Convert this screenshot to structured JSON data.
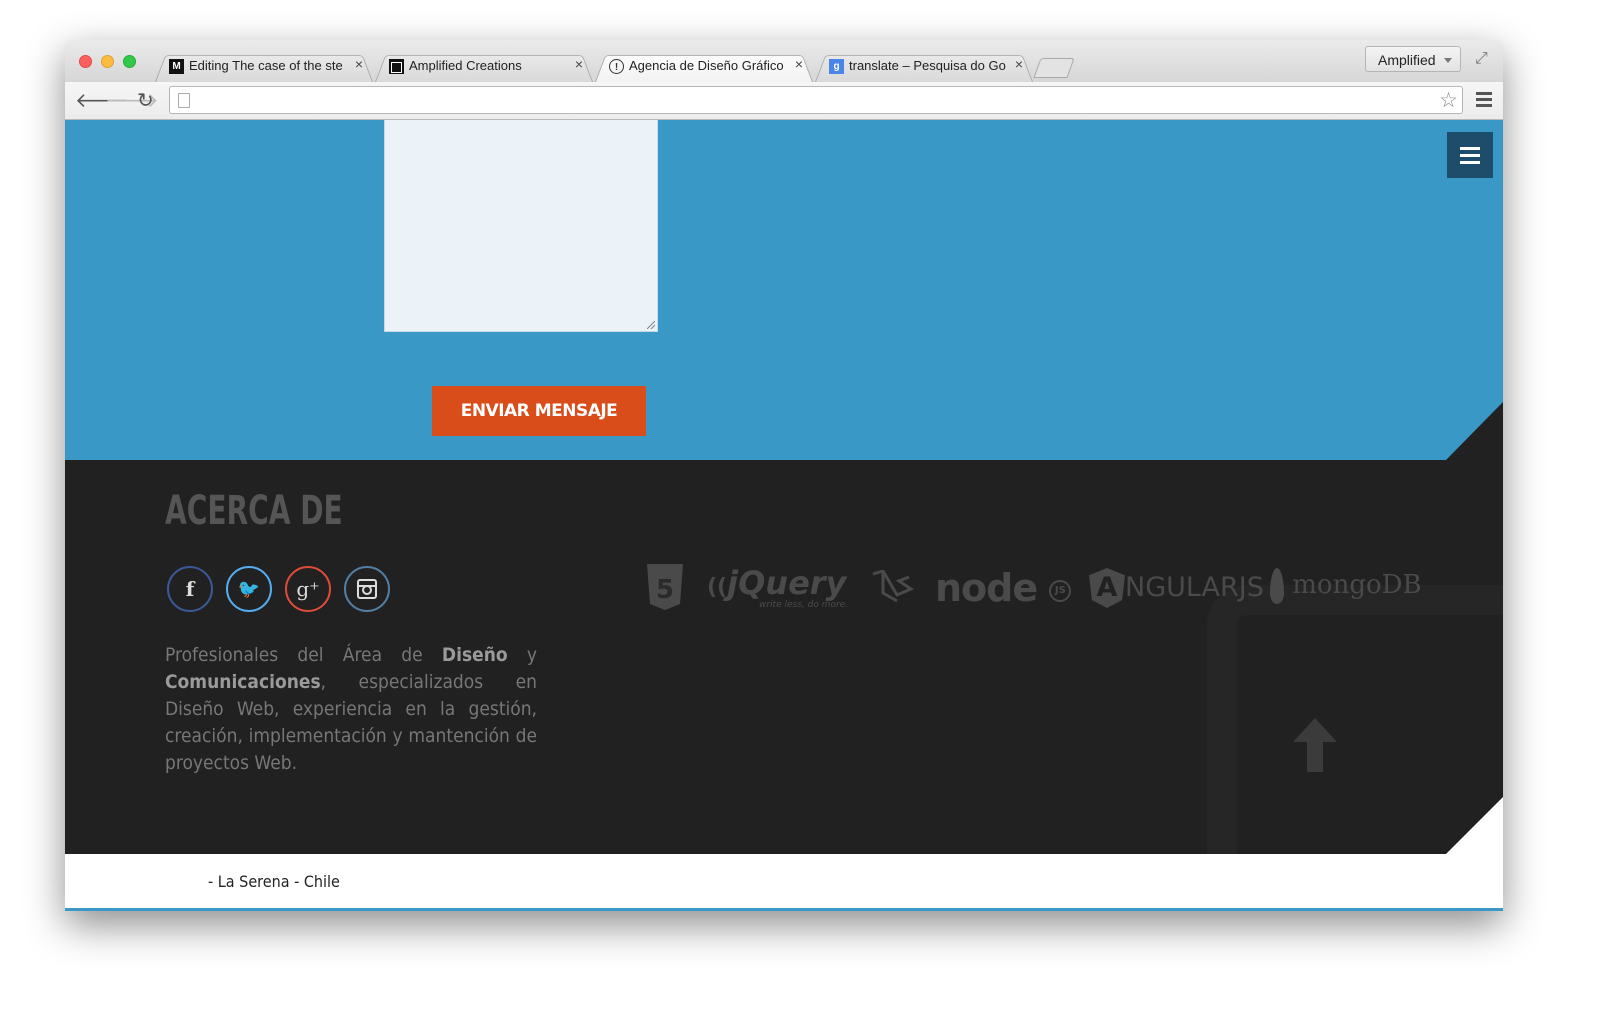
{
  "browser": {
    "tabs": [
      {
        "title": "Editing The case of the ste",
        "favicon": "M",
        "active": false
      },
      {
        "title": "Amplified Creations",
        "favicon": "square",
        "active": false
      },
      {
        "title": "Agencia de Diseño Gráfico",
        "favicon": "chat-bubble",
        "active": true
      },
      {
        "title": "translate – Pesquisa do Go",
        "favicon": "g",
        "active": false
      }
    ],
    "close_glyph": "×",
    "profile_label": "Amplified",
    "url": ""
  },
  "page": {
    "send_button": "ENVIAR MENSAJE",
    "about_title": "ACERCA DE",
    "about_text_parts": {
      "p1": "Profesionales del Área de ",
      "b1": "Diseño",
      "p2": " y ",
      "b2": "Comunicaciones",
      "p3": ", especializados en Diseño Web, experiencia en la gestión, creación, implementación y mantención de proyectos Web."
    },
    "social": [
      {
        "name": "facebook",
        "glyph": "f",
        "color": "#3b5998"
      },
      {
        "name": "twitter",
        "glyph": "🐦",
        "color": "#55acee"
      },
      {
        "name": "google-plus",
        "glyph": "g+",
        "color": "#dd4b39"
      },
      {
        "name": "instagram",
        "glyph": "◙",
        "color": "#517fa4"
      }
    ],
    "tech_logos": {
      "jquery": "jQuery",
      "jquery_tag": "write less, do more.",
      "node": "node",
      "node_sub": "JS",
      "angular": "NGULARJS",
      "angular_a": "A",
      "mongo": "mongoDB",
      "html5": "5"
    },
    "footer_text": "- La Serena - Chile"
  },
  "colors": {
    "blue_section": "#3a98c6",
    "dark_section": "#212121",
    "button": "#d94d1b",
    "menu_button": "#1e4d6b"
  }
}
